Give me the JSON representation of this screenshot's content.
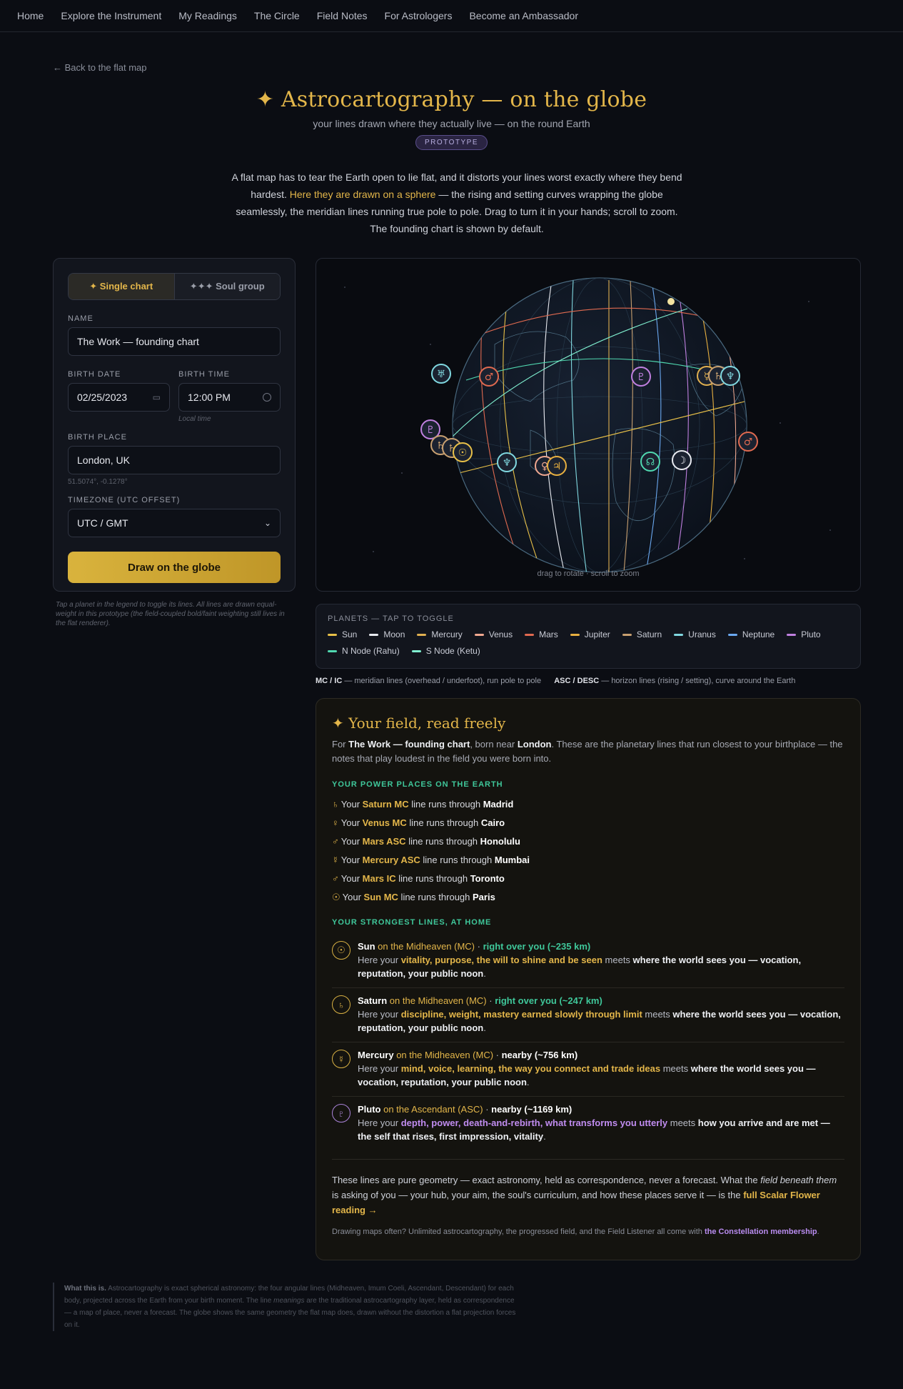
{
  "nav": [
    "Home",
    "Explore the Instrument",
    "My Readings",
    "The Circle",
    "Field Notes",
    "For Astrologers",
    "Become an Ambassador"
  ],
  "back_link": "← Back to the flat map",
  "hero": {
    "title": "✦ Astrocartography — on the globe",
    "subtitle": "your lines drawn where they actually live — on the round Earth",
    "badge": "PROTOTYPE"
  },
  "intro": {
    "part1": "A flat map has to tear the Earth open to lie flat, and it distorts your lines worst exactly where they bend hardest. ",
    "highlight": "Here they are drawn on a sphere",
    "part2": " — the rising and setting curves wrapping the globe seamlessly, the meridian lines running true pole to pole. Drag to turn it in your hands; scroll to zoom. The founding chart is shown by default."
  },
  "form": {
    "tab_single": "✦ Single chart",
    "tab_group": "✦✦✦ Soul group",
    "name_label": "NAME",
    "name_value": "The Work — founding chart",
    "date_label": "BIRTH DATE",
    "date_value": "02/25/2023",
    "time_label": "BIRTH TIME",
    "time_value": "12:00 PM",
    "time_hint": "Local time",
    "place_label": "BIRTH PLACE",
    "place_value": "London, UK",
    "coords": "51.5074°, -0.1278°",
    "tz_label": "TIMEZONE (UTC OFFSET)",
    "tz_value": "UTC / GMT",
    "draw_button": "Draw on the globe"
  },
  "panel_note": "Tap a planet in the legend to toggle its lines. All lines are drawn equal-weight in this prototype (the field-coupled bold/faint weighting still lives in the flat renderer).",
  "globe": {
    "caption": "drag to rotate · scroll to zoom",
    "markers": [
      "♅",
      "♂",
      "♇",
      "☿",
      "♄",
      "♆",
      "♇",
      "♄",
      "♄",
      "☉",
      "♆",
      "♀",
      "♃",
      "☊",
      "☽",
      "♂"
    ]
  },
  "legend": {
    "title": "PLANETS — TAP TO TOGGLE",
    "items": [
      {
        "name": "Sun",
        "color": "#e8c048"
      },
      {
        "name": "Moon",
        "color": "#e8eaf0"
      },
      {
        "name": "Mercury",
        "color": "#e0b050"
      },
      {
        "name": "Venus",
        "color": "#f0a890"
      },
      {
        "name": "Mars",
        "color": "#e06a50"
      },
      {
        "name": "Jupiter",
        "color": "#e8b040"
      },
      {
        "name": "Saturn",
        "color": "#c8a070"
      },
      {
        "name": "Uranus",
        "color": "#80d8e0"
      },
      {
        "name": "Neptune",
        "color": "#6aa8f0"
      },
      {
        "name": "Pluto",
        "color": "#c080e0"
      },
      {
        "name": "N Node (Rahu)",
        "color": "#50d8b0"
      },
      {
        "name": "S Node (Ketu)",
        "color": "#80f0d0"
      }
    ]
  },
  "axes_note": {
    "mc_label": "MC / IC",
    "mc_text": " — meridian lines (overhead / underfoot), run pole to pole",
    "asc_label": "ASC / DESC",
    "asc_text": " — horizon lines (rising / setting), curve around the Earth"
  },
  "reading": {
    "title": "✦ Your field, read freely",
    "intro_prefix": "For ",
    "intro_chart": "The Work — founding chart",
    "intro_mid": ", born near ",
    "intro_city": "London",
    "intro_suffix": ". These are the planetary lines that run closest to your birthplace — the notes that play loudest in the field you were born into.",
    "power_head": "YOUR POWER PLACES ON THE EARTH",
    "power_places": [
      {
        "glyph": "♄",
        "line": "Saturn MC",
        "city": "Madrid"
      },
      {
        "glyph": "♀",
        "line": "Venus MC",
        "city": "Cairo"
      },
      {
        "glyph": "♂",
        "line": "Mars ASC",
        "city": "Honolulu"
      },
      {
        "glyph": "☿",
        "line": "Mercury ASC",
        "city": "Mumbai"
      },
      {
        "glyph": "♂",
        "line": "Mars IC",
        "city": "Toronto"
      },
      {
        "glyph": "☉",
        "line": "Sun MC",
        "city": "Paris"
      }
    ],
    "power_your": "Your ",
    "power_runs": " line runs through ",
    "strong_head": "YOUR STRONGEST LINES, AT HOME",
    "strong_lines": [
      {
        "glyph": "☉",
        "planet": "Sun",
        "angle": " on the Midheaven (MC)",
        "sep": " · ",
        "dist": "right over you (~235 km)",
        "dist_style": "g",
        "here": "Here your ",
        "key": "vitality, purpose, the will to shine and be seen",
        "meets": " meets ",
        "meaning": "where the world sees you — vocation, reputation, your public noon",
        "end": "."
      },
      {
        "glyph": "♄",
        "planet": "Saturn",
        "angle": " on the Midheaven (MC)",
        "sep": " · ",
        "dist": "right over you (~247 km)",
        "dist_style": "g",
        "here": "Here your ",
        "key": "discipline, weight, mastery earned slowly through limit",
        "meets": " meets ",
        "meaning": "where the world sees you — vocation, reputation, your public noon",
        "end": "."
      },
      {
        "glyph": "☿",
        "planet": "Mercury",
        "angle": " on the Midheaven (MC)",
        "sep": " · ",
        "dist": "nearby (~756 km)",
        "dist_style": "w",
        "here": "Here your ",
        "key": "mind, voice, learning, the way you connect and trade ideas",
        "meets": " meets ",
        "meaning": "where the world sees you — vocation, reputation, your public noon",
        "end": "."
      },
      {
        "glyph": "♇",
        "planet": "Pluto",
        "angle": " on the Ascendant (ASC)",
        "sep": " · ",
        "dist": "nearby (~1169 km)",
        "dist_style": "w",
        "here": "Here your ",
        "key": "depth, power, death-and-rebirth, what transforms you utterly",
        "meets": " meets ",
        "meaning": "how you arrive and are met — the self that rises, first impression, vitality",
        "end": "."
      }
    ],
    "foot1_a": "These lines are pure geometry — exact astronomy, held as correspondence, never a forecast. What the ",
    "foot1_em": "field beneath them",
    "foot1_b": " is asking of you — your hub, your aim, the soul's curriculum, and how these places serve it — is the ",
    "foot1_link": "full Scalar Flower reading →",
    "foot2_a": "Drawing maps often? Unlimited astrocartography, the progressed field, and the Field Listener all come with ",
    "foot2_link": "the Constellation membership",
    "foot2_b": "."
  },
  "what_is": {
    "label": "What this is.",
    "text_a": " Astrocartography is exact spherical astronomy: the four angular lines (Midheaven, Imum Coeli, Ascendant, Descendant) for each body, projected across the Earth from your birth moment. The line ",
    "text_em": "meanings",
    "text_b": " are the traditional astrocartography layer, held as correspondence — a map of place, never a forecast. The globe shows the same geometry the flat map does, drawn without the distortion a flat projection forces on it."
  }
}
